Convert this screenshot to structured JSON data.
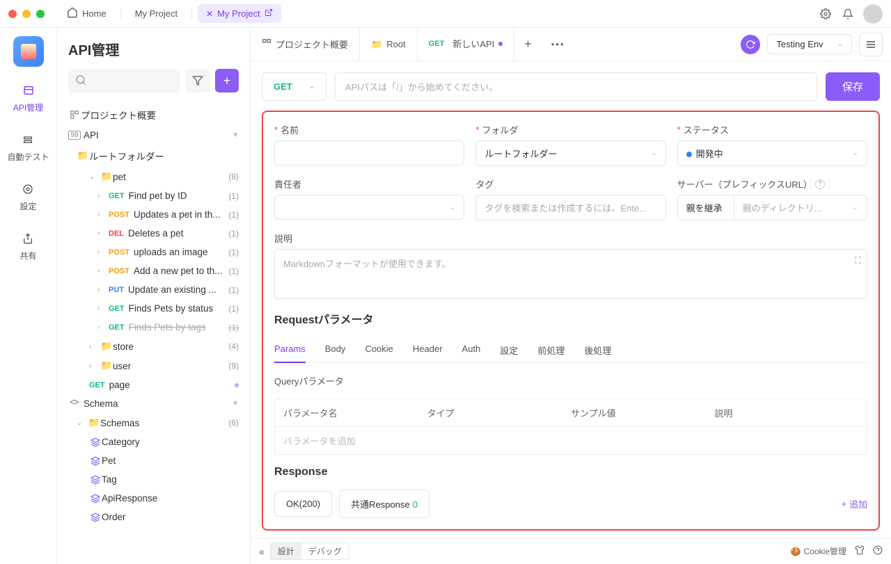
{
  "titlebar": {
    "tabs": [
      {
        "label": "Home",
        "icon": "home"
      },
      {
        "label": "My Project"
      },
      {
        "label": "My Project",
        "active": true
      }
    ]
  },
  "leftRail": {
    "items": [
      {
        "label": "API管理",
        "active": true
      },
      {
        "label": "自動テスト"
      },
      {
        "label": "設定"
      },
      {
        "label": "共有"
      }
    ]
  },
  "sidebar": {
    "title": "API管理",
    "projectOverview": "プロジェクト概要",
    "apiLabel": "API",
    "rootFolder": "ルートフォルダー",
    "folders": {
      "pet": {
        "name": "pet",
        "count": "(8)"
      },
      "store": {
        "name": "store",
        "count": "(4)"
      },
      "user": {
        "name": "user",
        "count": "(9)"
      }
    },
    "petApis": [
      {
        "method": "GET",
        "name": "Find pet by ID",
        "count": "(1)"
      },
      {
        "method": "POST",
        "name": "Updates a pet in th...",
        "count": "(1)"
      },
      {
        "method": "DEL",
        "name": "Deletes a pet",
        "count": "(1)"
      },
      {
        "method": "POST",
        "name": "uploads an image",
        "count": "(1)"
      },
      {
        "method": "POST",
        "name": "Add a new pet to th...",
        "count": "(1)"
      },
      {
        "method": "PUT",
        "name": "Update an existing ...",
        "count": "(1)"
      },
      {
        "method": "GET",
        "name": "Finds Pets by status",
        "count": "(1)"
      },
      {
        "method": "GET",
        "name": "Finds Pets by tags",
        "count": "(1)",
        "deprecated": true
      }
    ],
    "pageApi": {
      "method": "GET",
      "name": "page"
    },
    "schemaLabel": "Schema",
    "schemasFolder": {
      "name": "Schemas",
      "count": "(6)"
    },
    "schemas": [
      "Category",
      "Pet",
      "Tag",
      "ApiResponse",
      "Order"
    ]
  },
  "contentTabs": {
    "tabs": [
      {
        "label": "プロジェクト概要"
      },
      {
        "label": "Root"
      },
      {
        "method": "GET",
        "label": "新しいAPI",
        "active": true,
        "modified": true
      }
    ],
    "env": "Testing Env"
  },
  "urlBar": {
    "method": "GET",
    "placeholder": "APIパスは「/」から始めてください。",
    "save": "保存"
  },
  "form": {
    "name": {
      "label": "名前"
    },
    "folder": {
      "label": "フォルダ",
      "value": "ルートフォルダー"
    },
    "status": {
      "label": "ステータス",
      "value": "開発中"
    },
    "owner": {
      "label": "責任者"
    },
    "tag": {
      "label": "タグ",
      "placeholder": "タグを検索または作成するには、Ente..."
    },
    "server": {
      "label": "サーバー（プレフィックスURL）",
      "left": "親を継承",
      "right": "親のディレクトリ..."
    },
    "description": {
      "label": "説明",
      "placeholder": "Markdownフォーマットが使用できます。"
    }
  },
  "request": {
    "title": "Requestパラメータ",
    "tabs": [
      "Params",
      "Body",
      "Cookie",
      "Header",
      "Auth",
      "設定",
      "前処理",
      "後処理"
    ],
    "queryLabel": "Queryパラメータ",
    "columns": [
      "パラメータ名",
      "タイプ",
      "サンプル値",
      "説明"
    ],
    "addPlaceholder": "パラメータを追加"
  },
  "response": {
    "title": "Response",
    "ok": "OK(200)",
    "common": "共通Response",
    "commonCount": "0",
    "add": "追加"
  },
  "footer": {
    "modes": [
      "設計",
      "デバッグ"
    ],
    "cookie": "Cookie管理"
  }
}
